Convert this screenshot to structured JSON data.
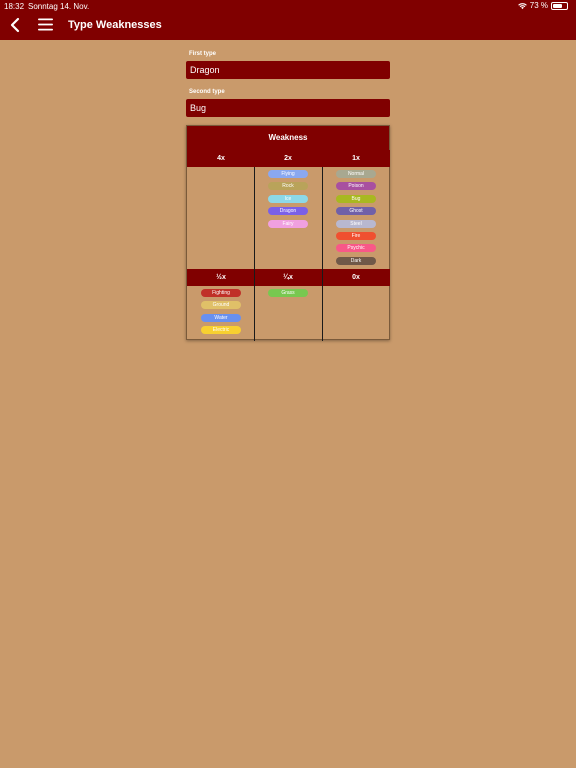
{
  "status": {
    "time": "18:32",
    "date": "Sonntag 14. Nov.",
    "battery": "73 %"
  },
  "header": {
    "title": "Type Weaknesses"
  },
  "form": {
    "first_type_label": "First type",
    "first_type_value": "Dragon",
    "second_type_label": "Second type",
    "second_type_value": "Bug"
  },
  "weakness": {
    "title": "Weakness",
    "columns": [
      {
        "label": "4x",
        "types": []
      },
      {
        "label": "2x",
        "types": [
          {
            "name": "Flying",
            "color": "#8aa8f0"
          },
          {
            "name": "Rock",
            "color": "#b9a35a"
          },
          {
            "name": "Ice",
            "color": "#8cd8e8"
          },
          {
            "name": "Dragon",
            "color": "#7a60e8"
          },
          {
            "name": "Fairy",
            "color": "#f0a0e0"
          }
        ]
      },
      {
        "label": "1x",
        "types": [
          {
            "name": "Normal",
            "color": "#a8a890"
          },
          {
            "name": "Poison",
            "color": "#a850a0"
          },
          {
            "name": "Bug",
            "color": "#a8b820"
          },
          {
            "name": "Ghost",
            "color": "#7060a8"
          },
          {
            "name": "Steel",
            "color": "#b8b8d0"
          },
          {
            "name": "Fire",
            "color": "#f05030"
          },
          {
            "name": "Psychic",
            "color": "#f85888"
          },
          {
            "name": "Dark",
            "color": "#705848"
          }
        ]
      },
      {
        "label": "½x",
        "types": [
          {
            "name": "Fighting",
            "color": "#c03028"
          },
          {
            "name": "Ground",
            "color": "#e0c068"
          },
          {
            "name": "Water",
            "color": "#6890f0"
          },
          {
            "name": "Electric",
            "color": "#f8d030"
          }
        ]
      },
      {
        "label": "¼x",
        "types": [
          {
            "name": "Grass",
            "color": "#78c850"
          }
        ]
      },
      {
        "label": "0x",
        "types": []
      }
    ]
  }
}
